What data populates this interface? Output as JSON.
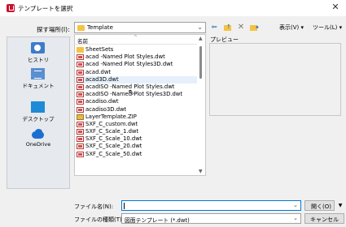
{
  "window": {
    "title": "テンプレートを選択",
    "close_glyph": "✕"
  },
  "toolbar": {
    "lookin_label": "探す場所(I):",
    "lookin_value": "Template",
    "back_glyph": "⬅",
    "delete_glyph": "✕",
    "views_label": "表示(V) ▾",
    "tools_label": "ツール(L) ▾"
  },
  "places": [
    {
      "label": "ヒストリ",
      "icon": "history-icon"
    },
    {
      "label": "ドキュメント",
      "icon": "documents-icon"
    },
    {
      "label": "デスクトップ",
      "icon": "desktop-icon"
    },
    {
      "label": "OneDrive",
      "icon": "onedrive-icon"
    }
  ],
  "filelist": {
    "column_name": "名前",
    "items": [
      {
        "name": "SheetSets",
        "type": "folder"
      },
      {
        "name": "acad -Named Plot Styles.dwt",
        "type": "dwt"
      },
      {
        "name": "acad -Named Plot Styles3D.dwt",
        "type": "dwt"
      },
      {
        "name": "acad.dwt",
        "type": "dwt"
      },
      {
        "name": "acad3D.dwt",
        "type": "dwt"
      },
      {
        "name": "acadISO -Named Plot Styles.dwt",
        "type": "dwt"
      },
      {
        "name": "acadISO -Named Plot Styles3D.dwt",
        "type": "dwt"
      },
      {
        "name": "acadiso.dwt",
        "type": "dwt"
      },
      {
        "name": "acadiso3D.dwt",
        "type": "dwt"
      },
      {
        "name": "LayerTemplate.ZIP",
        "type": "zip"
      },
      {
        "name": "SXF_C_custom.dwt",
        "type": "dwt"
      },
      {
        "name": "SXF_C_Scale_1.dwt",
        "type": "dwt"
      },
      {
        "name": "SXF_C_Scale_10.dwt",
        "type": "dwt"
      },
      {
        "name": "SXF_C_Scale_20.dwt",
        "type": "dwt"
      },
      {
        "name": "SXF_C_Scale_50.dwt",
        "type": "dwt"
      }
    ]
  },
  "preview": {
    "label": "プレビュー"
  },
  "footer": {
    "filename_label": "ファイル名(N):",
    "filename_value": "",
    "filetype_label": "ファイルの種類(T):",
    "filetype_value": "図面テンプレート (*.dwt)",
    "open_label": "開く(O)",
    "cancel_label": "キャンセル"
  }
}
